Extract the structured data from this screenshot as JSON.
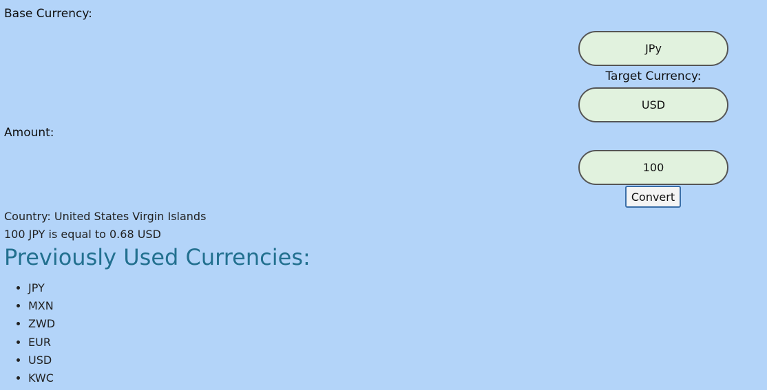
{
  "form": {
    "base_label": "Base Currency:",
    "base_value": "JPy",
    "target_label": "Target Currency:",
    "target_value": "USD",
    "amount_label": "Amount:",
    "amount_value": "100",
    "convert_label": "Convert"
  },
  "result": {
    "country": "Country: United States Virgin Islands",
    "conversion": "100 JPY is equal to 0.68 USD"
  },
  "history": {
    "title": "Previously Used Currencies:",
    "items": [
      "JPY",
      "MXN",
      "ZWD",
      "EUR",
      "USD",
      "KWC"
    ]
  },
  "colors": {
    "background": "#b3d4f9",
    "input_fill": "#e1f2de",
    "heading": "#22708f"
  }
}
